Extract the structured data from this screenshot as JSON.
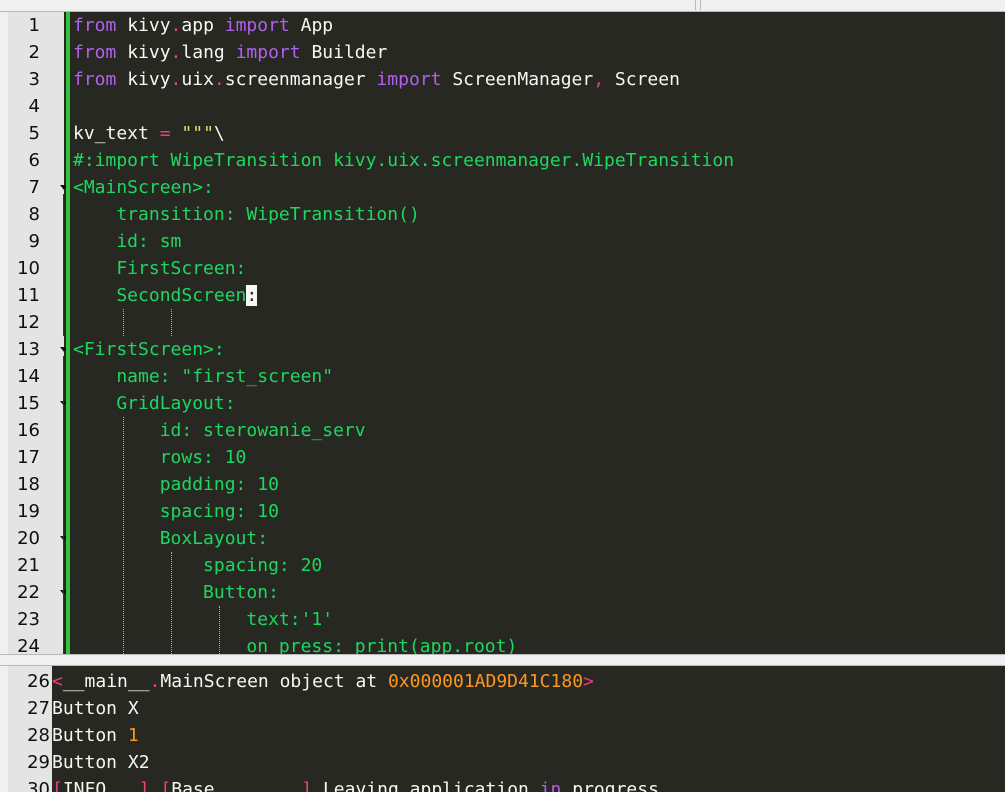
{
  "editor": {
    "lines": [
      {
        "n": "1",
        "parts": [
          [
            "kw",
            "from"
          ],
          [
            "mod",
            " kivy"
          ],
          [
            "dot",
            "."
          ],
          [
            "mod",
            "app "
          ],
          [
            "kw",
            "import"
          ],
          [
            "mod",
            " App"
          ]
        ]
      },
      {
        "n": "2",
        "parts": [
          [
            "kw",
            "from"
          ],
          [
            "mod",
            " kivy"
          ],
          [
            "dot",
            "."
          ],
          [
            "mod",
            "lang "
          ],
          [
            "kw",
            "import"
          ],
          [
            "mod",
            " Builder"
          ]
        ]
      },
      {
        "n": "3",
        "parts": [
          [
            "kw",
            "from"
          ],
          [
            "mod",
            " kivy"
          ],
          [
            "dot",
            "."
          ],
          [
            "mod",
            "uix"
          ],
          [
            "dot",
            "."
          ],
          [
            "mod",
            "screenmanager "
          ],
          [
            "kw",
            "import"
          ],
          [
            "mod",
            " ScreenManager"
          ],
          [
            "dot",
            ","
          ],
          [
            "mod",
            " Screen"
          ]
        ]
      },
      {
        "n": "4",
        "parts": []
      },
      {
        "n": "5",
        "parts": [
          [
            "mod",
            "kv_text "
          ],
          [
            "op",
            "="
          ],
          [
            "mod",
            " "
          ],
          [
            "str",
            "\"\"\""
          ],
          [
            "mod",
            "\\"
          ]
        ]
      },
      {
        "n": "6",
        "parts": [
          [
            "cmt",
            "#:import WipeTransition kivy.uix.screenmanager.WipeTransition"
          ]
        ]
      },
      {
        "n": "7",
        "parts": [
          [
            "kv",
            "<MainScreen>:"
          ]
        ]
      },
      {
        "n": "8",
        "parts": [
          [
            "kv",
            "    transition: WipeTransition()"
          ]
        ]
      },
      {
        "n": "9",
        "parts": [
          [
            "kv",
            "    id: sm"
          ]
        ]
      },
      {
        "n": "10",
        "parts": [
          [
            "kv",
            "    FirstScreen:"
          ]
        ]
      },
      {
        "n": "11",
        "parts": [
          [
            "kv",
            "    SecondScreen"
          ],
          [
            "cursor",
            ":"
          ]
        ]
      },
      {
        "n": "12",
        "parts": []
      },
      {
        "n": "13",
        "parts": [
          [
            "kv",
            "<FirstScreen>:"
          ]
        ]
      },
      {
        "n": "14",
        "parts": [
          [
            "kv",
            "    name: \"first_screen\""
          ]
        ]
      },
      {
        "n": "15",
        "parts": [
          [
            "kv",
            "    GridLayout:"
          ]
        ]
      },
      {
        "n": "16",
        "parts": [
          [
            "kv",
            "        id: sterowanie_serv"
          ]
        ]
      },
      {
        "n": "17",
        "parts": [
          [
            "kv",
            "        rows: 10"
          ]
        ]
      },
      {
        "n": "18",
        "parts": [
          [
            "kv",
            "        padding: 10"
          ]
        ]
      },
      {
        "n": "19",
        "parts": [
          [
            "kv",
            "        spacing: 10"
          ]
        ]
      },
      {
        "n": "20",
        "parts": [
          [
            "kv",
            "        BoxLayout:"
          ]
        ]
      },
      {
        "n": "21",
        "parts": [
          [
            "kv",
            "            spacing: 20"
          ]
        ]
      },
      {
        "n": "22",
        "parts": [
          [
            "kv",
            "            Button:"
          ]
        ]
      },
      {
        "n": "23",
        "parts": [
          [
            "kv",
            "                text:'1'"
          ]
        ]
      },
      {
        "n": "24",
        "parts": [
          [
            "kv",
            "                on_press: print(app.root)"
          ]
        ]
      }
    ]
  },
  "console": {
    "lines": [
      {
        "n": "26",
        "parts": [
          [
            "dot",
            "<"
          ],
          [
            "mod",
            "__main__"
          ],
          [
            "dot",
            "."
          ],
          [
            "mod",
            "MainScreen object at "
          ],
          [
            "hex",
            "0x000001AD9D41C180"
          ],
          [
            "dot",
            ">"
          ]
        ]
      },
      {
        "n": "27",
        "parts": [
          [
            "mod",
            "Button X"
          ]
        ]
      },
      {
        "n": "28",
        "parts": [
          [
            "mod",
            "Button "
          ],
          [
            "onev",
            "1"
          ]
        ]
      },
      {
        "n": "29",
        "parts": [
          [
            "mod",
            "Button X2"
          ]
        ]
      },
      {
        "n": "30",
        "parts": [
          [
            "dot",
            "["
          ],
          [
            "mod",
            "INFO   "
          ],
          [
            "dot",
            "]"
          ],
          [
            "mod",
            " "
          ],
          [
            "dot",
            "["
          ],
          [
            "mod",
            "Base        "
          ],
          [
            "dot",
            "]"
          ],
          [
            "mod",
            " Leaving application "
          ],
          [
            "kw",
            "in"
          ],
          [
            "mod",
            " progress"
          ],
          [
            "dot",
            "."
          ],
          [
            "mod",
            "."
          ],
          [
            "dot",
            "."
          ]
        ]
      }
    ]
  }
}
